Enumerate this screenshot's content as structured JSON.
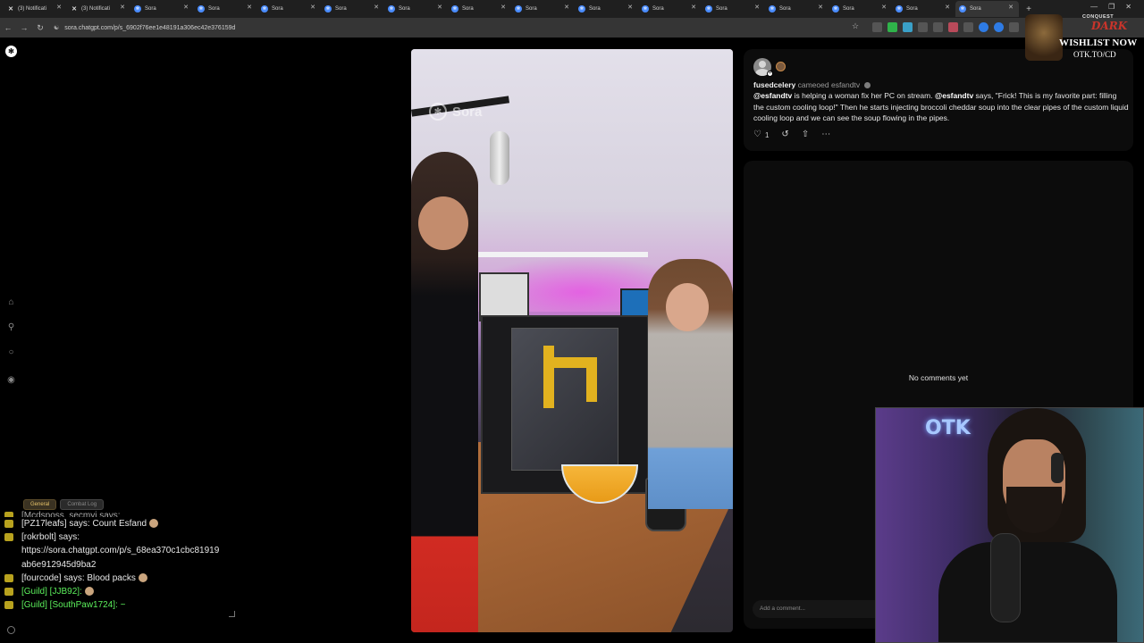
{
  "browser": {
    "tabs": [
      {
        "title": "(3) Notificati",
        "icon": "x-logo-icon"
      },
      {
        "title": "(3) Notificati",
        "icon": "x-logo-icon"
      },
      {
        "title": "Sora",
        "icon": "sora-icon"
      },
      {
        "title": "Sora",
        "icon": "sora-icon"
      },
      {
        "title": "Sora",
        "icon": "sora-icon"
      },
      {
        "title": "Sora",
        "icon": "sora-icon"
      },
      {
        "title": "Sora",
        "icon": "sora-icon"
      },
      {
        "title": "Sora",
        "icon": "sora-icon"
      },
      {
        "title": "Sora",
        "icon": "sora-icon"
      },
      {
        "title": "Sora",
        "icon": "sora-icon"
      },
      {
        "title": "Sora",
        "icon": "sora-icon"
      },
      {
        "title": "Sora",
        "icon": "sora-icon"
      },
      {
        "title": "Sora",
        "icon": "sora-icon"
      },
      {
        "title": "Sora",
        "icon": "sora-icon"
      },
      {
        "title": "Sora",
        "icon": "sora-icon"
      },
      {
        "title": "Sora",
        "icon": "sora-icon",
        "active": true
      }
    ],
    "url": "sora.chatgpt.com/p/s_6902f76ee1e48191a306ec42e376159d"
  },
  "video": {
    "watermark": "Sora"
  },
  "post": {
    "author": "fusedcelery",
    "action": "cameoed",
    "cameo_user": "esfandtv",
    "caption_parts": {
      "mention1": "@esfandtv",
      "text1": " is helping a woman fix her PC on stream. ",
      "mention2": "@esfandtv",
      "text2": " says, \"Frick! This is my favorite part: filling the custom cooling loop!\" Then he starts injecting broccoli cheddar soup into the clear pipes of the custom liquid cooling loop and we can see the soup flowing in the pipes."
    },
    "like_count": "1"
  },
  "comments": {
    "empty_text": "No comments yet",
    "input_placeholder": "Add a comment..."
  },
  "promo": {
    "small": "CONQUEST",
    "title": "DARK",
    "wishlist": "WISHLIST NOW",
    "url": "OTK.TO/CD"
  },
  "webcam": {
    "neon_sign": "OTK"
  },
  "chat": {
    "tabs": [
      "General",
      "Combat Log"
    ],
    "lines": [
      {
        "text": "[Mcdsposs_secmyj says:",
        "cut": true
      },
      {
        "text": "[PZ17leafs] says:  Count Esfand",
        "emote": true
      },
      {
        "text": "[rokrbolt] says:"
      },
      {
        "text": "https://sora.chatgpt.com/p/s_68ea370c1cbc81919"
      },
      {
        "text": "ab6e912945d9ba2"
      },
      {
        "text": "[fourcode] says:  Blood packs",
        "emote": true
      },
      {
        "text": "[Guild] [JJB92]:",
        "guild": true,
        "emote": true
      },
      {
        "text": "[Guild] [SouthPaw1724]:  ~",
        "guild": true
      }
    ]
  }
}
